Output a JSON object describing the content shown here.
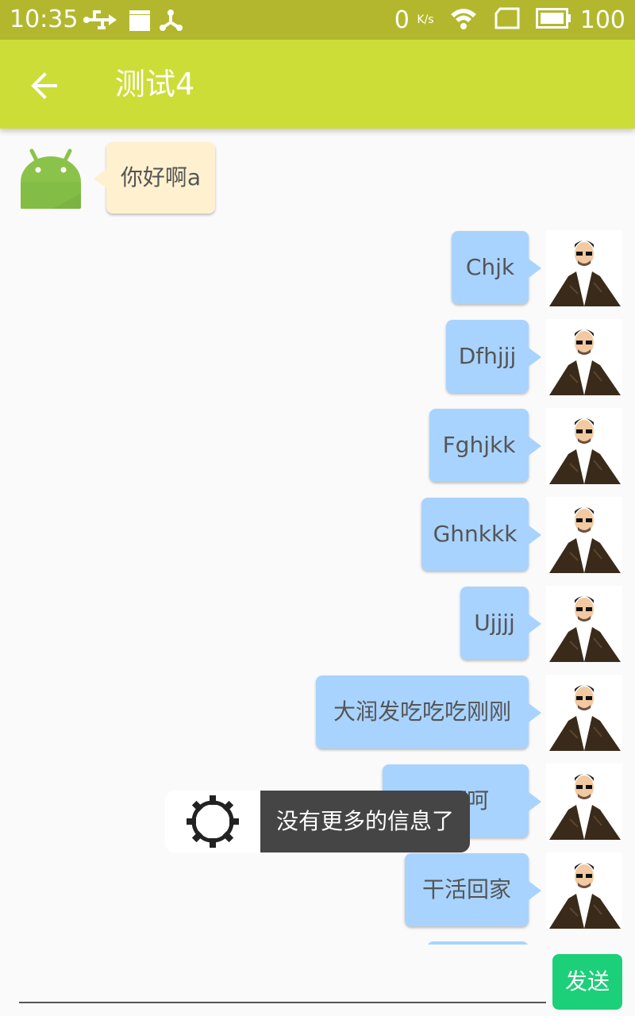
{
  "status": {
    "time": "10:35",
    "speed": "0",
    "speed_unit": "K/s",
    "battery": "100"
  },
  "appbar": {
    "title": "测试4",
    "back_icon": "arrow-back-icon"
  },
  "messages": [
    {
      "side": "incoming",
      "text": "你好啊a",
      "avatar": "android-robot-avatar"
    },
    {
      "side": "outgoing",
      "text": "Chjk",
      "avatar": "user-avatar"
    },
    {
      "side": "outgoing",
      "text": "Dfhjjj",
      "avatar": "user-avatar"
    },
    {
      "side": "outgoing",
      "text": "Fghjkk",
      "avatar": "user-avatar"
    },
    {
      "side": "outgoing",
      "text": "Ghnkkk",
      "avatar": "user-avatar"
    },
    {
      "side": "outgoing",
      "text": "Ujjjj",
      "avatar": "user-avatar"
    },
    {
      "side": "outgoing",
      "text": "大润发吃吃吃刚刚",
      "avatar": "user-avatar"
    },
    {
      "side": "outgoing",
      "text": "…呵呵",
      "avatar": "user-avatar"
    },
    {
      "side": "outgoing",
      "text": "干活回家",
      "avatar": "user-avatar"
    }
  ],
  "toast": {
    "text": "没有更多的信息了",
    "icon": "gear-icon"
  },
  "composer": {
    "input_value": "",
    "send_label": "发送"
  },
  "colors": {
    "statusbar": "#b3b72d",
    "appbar": "#cddd37",
    "incoming_bubble": "#fff1cf",
    "outgoing_bubble": "#a8d3ff",
    "send_button": "#1ccf79"
  }
}
